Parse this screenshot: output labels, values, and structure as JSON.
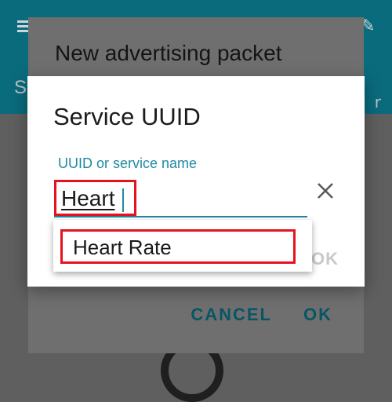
{
  "back_dialog": {
    "title": "New advertising packet",
    "cancel_label": "CANCEL",
    "ok_label": "OK"
  },
  "background": {
    "tab_letter": "S",
    "right_char": "r"
  },
  "dialog": {
    "title": "Service UUID",
    "field_label": "UUID or service name",
    "input_value": "Heart",
    "ok_label": "OK"
  },
  "suggestions": [
    {
      "label": "Heart Rate"
    }
  ],
  "icons": {
    "menu": "menu-icon",
    "edit": "pencil-icon",
    "clear": "close-icon"
  },
  "colors": {
    "accent": "#1f8aa3",
    "app_bar": "#0a6b7d",
    "highlight": "#e5121f"
  }
}
